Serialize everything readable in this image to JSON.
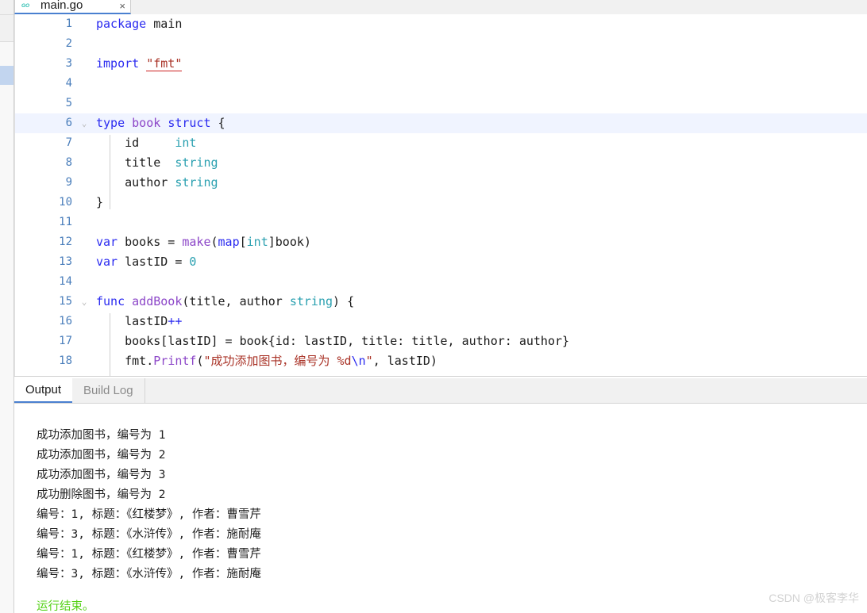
{
  "window": {
    "file_tab": {
      "label": "main.go",
      "icon": "go-gopher-icon",
      "close_label": "×"
    }
  },
  "editor": {
    "language": "go",
    "current_line": 6,
    "lines": [
      {
        "n": "1",
        "fold": "",
        "tokens": [
          {
            "t": "package",
            "c": "kw"
          },
          {
            "t": " ",
            "c": "pl"
          },
          {
            "t": "main",
            "c": "pl"
          }
        ]
      },
      {
        "n": "2",
        "fold": "",
        "tokens": []
      },
      {
        "n": "3",
        "fold": "",
        "tokens": [
          {
            "t": "import",
            "c": "kw"
          },
          {
            "t": " ",
            "c": "pl"
          },
          {
            "t": "\"fmt\"",
            "c": "err"
          }
        ]
      },
      {
        "n": "4",
        "fold": "",
        "tokens": []
      },
      {
        "n": "5",
        "fold": "",
        "tokens": []
      },
      {
        "n": "6",
        "fold": "v",
        "tokens": [
          {
            "t": "type",
            "c": "kw"
          },
          {
            "t": " ",
            "c": "pl"
          },
          {
            "t": "book",
            "c": "fn"
          },
          {
            "t": " ",
            "c": "pl"
          },
          {
            "t": "struct",
            "c": "kw"
          },
          {
            "t": " {",
            "c": "pl"
          }
        ]
      },
      {
        "n": "7",
        "fold": "",
        "tokens": [
          {
            "t": "    id     ",
            "c": "pl"
          },
          {
            "t": "int",
            "c": "typ"
          }
        ]
      },
      {
        "n": "8",
        "fold": "",
        "tokens": [
          {
            "t": "    title  ",
            "c": "pl"
          },
          {
            "t": "string",
            "c": "typ"
          }
        ]
      },
      {
        "n": "9",
        "fold": "",
        "tokens": [
          {
            "t": "    author ",
            "c": "pl"
          },
          {
            "t": "string",
            "c": "typ"
          }
        ]
      },
      {
        "n": "10",
        "fold": "",
        "tokens": [
          {
            "t": "}",
            "c": "pl"
          }
        ]
      },
      {
        "n": "11",
        "fold": "",
        "tokens": []
      },
      {
        "n": "12",
        "fold": "",
        "tokens": [
          {
            "t": "var",
            "c": "kw"
          },
          {
            "t": " books = ",
            "c": "pl"
          },
          {
            "t": "make",
            "c": "fn"
          },
          {
            "t": "(",
            "c": "pl"
          },
          {
            "t": "map",
            "c": "kw"
          },
          {
            "t": "[",
            "c": "pl"
          },
          {
            "t": "int",
            "c": "typ"
          },
          {
            "t": "]book)",
            "c": "pl"
          }
        ]
      },
      {
        "n": "13",
        "fold": "",
        "tokens": [
          {
            "t": "var",
            "c": "kw"
          },
          {
            "t": " lastID = ",
            "c": "pl"
          },
          {
            "t": "0",
            "c": "num"
          }
        ]
      },
      {
        "n": "14",
        "fold": "",
        "tokens": []
      },
      {
        "n": "15",
        "fold": "v",
        "tokens": [
          {
            "t": "func",
            "c": "kw"
          },
          {
            "t": " ",
            "c": "pl"
          },
          {
            "t": "addBook",
            "c": "fn"
          },
          {
            "t": "(title, author ",
            "c": "pl"
          },
          {
            "t": "string",
            "c": "typ"
          },
          {
            "t": ") {",
            "c": "pl"
          }
        ]
      },
      {
        "n": "16",
        "fold": "",
        "tokens": [
          {
            "t": "    lastID",
            "c": "pl"
          },
          {
            "t": "++",
            "c": "kw2"
          }
        ]
      },
      {
        "n": "17",
        "fold": "",
        "tokens": [
          {
            "t": "    books[lastID] = book{id: lastID, title: title, author: author}",
            "c": "pl"
          }
        ]
      },
      {
        "n": "18",
        "fold": "",
        "tokens": [
          {
            "t": "    fmt.",
            "c": "pl"
          },
          {
            "t": "Printf",
            "c": "fn"
          },
          {
            "t": "(",
            "c": "pl"
          },
          {
            "t": "\"成功添加图书，编号为 %d",
            "c": "str"
          },
          {
            "t": "\\n",
            "c": "esc"
          },
          {
            "t": "\"",
            "c": "str"
          },
          {
            "t": ", lastID)",
            "c": "pl"
          }
        ]
      }
    ]
  },
  "panel": {
    "tabs": [
      {
        "label": "Output",
        "active": true
      },
      {
        "label": "Build Log",
        "active": false
      }
    ],
    "console_lines": [
      {
        "text": "成功添加图书，编号为 1",
        "state": "normal"
      },
      {
        "text": "成功添加图书，编号为 2",
        "state": "normal"
      },
      {
        "text": "成功添加图书，编号为 3",
        "state": "normal"
      },
      {
        "text": "成功删除图书，编号为 2",
        "state": "normal"
      },
      {
        "text": "编号：1, 标题：《红楼梦》, 作者：曹雪芹",
        "state": "normal"
      },
      {
        "text": "编号：3, 标题：《水浒传》, 作者：施耐庵",
        "state": "normal"
      },
      {
        "text": "编号：1, 标题：《红楼梦》, 作者：曹雪芹",
        "state": "normal"
      },
      {
        "text": "编号：3, 标题：《水浒传》, 作者：施耐庵",
        "state": "normal"
      },
      {
        "text": "运行结束。",
        "state": "done"
      }
    ]
  },
  "watermark": {
    "text": "CSDN @极客李华"
  },
  "colors": {
    "accent": "#4a80d0",
    "current_line_bg": "#f0f4ff",
    "gutter_number": "#4a7ebb",
    "keyword": "#2a2af0",
    "function": "#8c46c8",
    "type": "#2aa0b0",
    "string": "#a93226",
    "success": "#54d117",
    "rail_selected": "#c2d5ef"
  }
}
